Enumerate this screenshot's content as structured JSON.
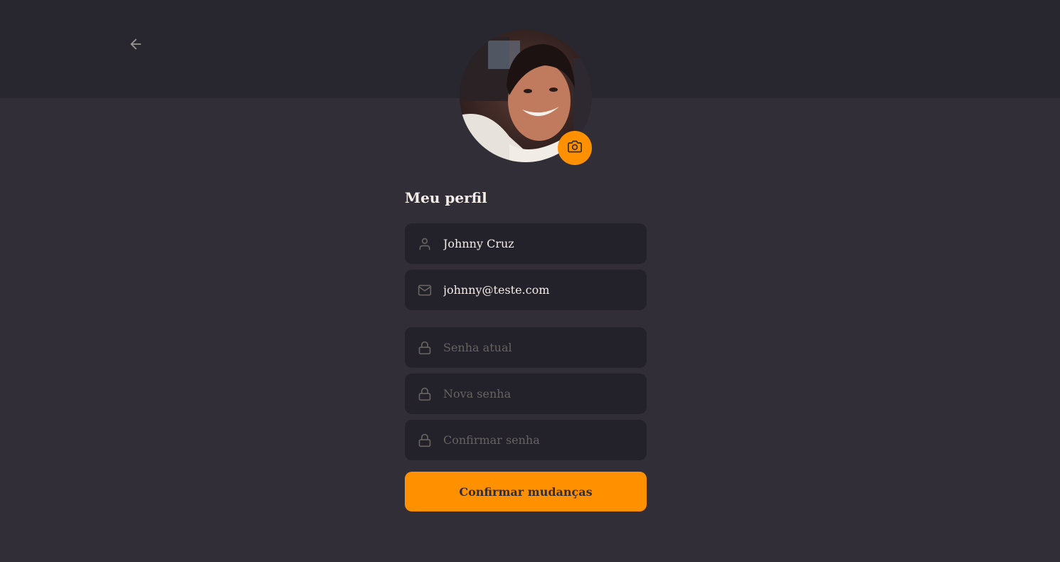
{
  "header": {
    "back_icon": "arrow-left-icon"
  },
  "avatar": {
    "alt": "Johnny Cruz",
    "camera_icon": "camera-icon"
  },
  "form": {
    "title": "Meu perfil",
    "name": {
      "value": "Johnny Cruz",
      "icon": "user-icon"
    },
    "email": {
      "value": "johnny@teste.com",
      "icon": "mail-icon"
    },
    "old_password": {
      "placeholder": "Senha atual",
      "value": "",
      "icon": "lock-icon"
    },
    "new_password": {
      "placeholder": "Nova senha",
      "value": "",
      "icon": "lock-icon"
    },
    "confirm_password": {
      "placeholder": "Confirmar senha",
      "value": "",
      "icon": "lock-icon"
    },
    "submit_label": "Confirmar mudanças"
  },
  "colors": {
    "background": "#312e38",
    "header_background": "#28262e",
    "input_background": "#232129",
    "accent": "#ff9000",
    "text": "#f4ede8",
    "placeholder": "#666360"
  }
}
